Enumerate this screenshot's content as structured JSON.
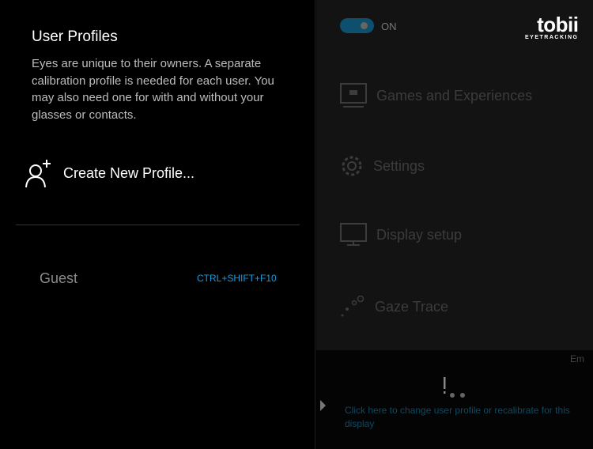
{
  "profiles": {
    "title": "User Profiles",
    "description": "Eyes are unique to their owners. A separate calibration profile is needed for each user. You may also need one for with and without your glasses or contacts.",
    "create_label": "Create New Profile...",
    "items": [
      {
        "name": "Guest",
        "shortcut": "CTRL+SHIFT+F10"
      }
    ]
  },
  "header": {
    "toggle_label": "ON",
    "toggle_on": true,
    "logo": "tobii",
    "logo_sub": "EYETRACKING"
  },
  "menu": [
    {
      "label": "Games and Experiences",
      "icon": "games-icon"
    },
    {
      "label": "Settings",
      "icon": "gear-icon"
    },
    {
      "label": "Display setup",
      "icon": "monitor-icon"
    },
    {
      "label": "Gaze Trace",
      "icon": "gaze-trace-icon"
    }
  ],
  "footer": {
    "corner_text": "Em",
    "link": "Click here to change user profile or recalibrate for this display"
  },
  "colors": {
    "accent": "#1a9ae0",
    "toggle": "#0e4f6e"
  }
}
